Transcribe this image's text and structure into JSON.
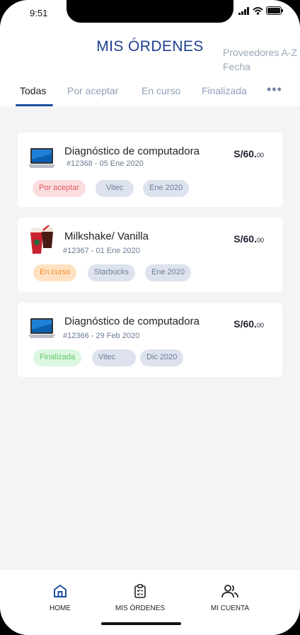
{
  "status": {
    "time": "9:51"
  },
  "header": {
    "title": "MIS ÓRDENES",
    "sort_line1": "Proveedores A-Z",
    "sort_line2": "Fecha"
  },
  "tabs": [
    {
      "label": "Todas"
    },
    {
      "label": "Por aceptar"
    },
    {
      "label": "En curso"
    },
    {
      "label": "Finalizada"
    }
  ],
  "more": "•••",
  "orders": [
    {
      "name": "Diagnóstico de computadora",
      "id_date": "#12368 - 05 Ene 2020",
      "price_main": "S/60.",
      "price_cents": "00",
      "status": "Por aceptar",
      "vendor": "Vitec",
      "month": "Ene 2020",
      "icon": "laptop-icon"
    },
    {
      "name": "Milkshake/ Vanilla",
      "id_date": "#12367 - 01 Ene 2020",
      "price_main": "S/60.",
      "price_cents": "00",
      "status": "En curso",
      "vendor": "Starbucks",
      "month": "Ene 2020",
      "icon": "drink-icon"
    },
    {
      "name": "Diagnóstico de computadora",
      "id_date": "#12366 - 29 Feb 2020",
      "price_main": "S/60.",
      "price_cents": "00",
      "status": "Finalizada",
      "vendor": "Vitec",
      "month": "Dic 2020",
      "icon": "laptop-icon"
    }
  ],
  "bottom_nav": [
    {
      "label": "HOME",
      "icon": "home-icon"
    },
    {
      "label": "MIS ÓRDENES",
      "icon": "clipboard-icon"
    },
    {
      "label": "MI CUENTA",
      "icon": "users-icon"
    }
  ],
  "colors": {
    "primary": "#1d3f8f",
    "red": "#e25a5f",
    "orange": "#f08a2c",
    "green": "#63c86d"
  }
}
